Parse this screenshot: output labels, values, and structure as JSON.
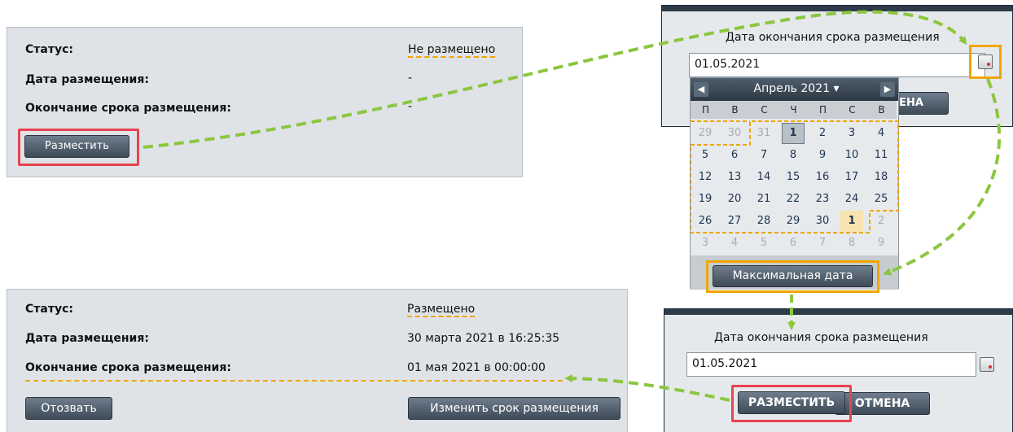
{
  "top_panel": {
    "status_label": "Статус:",
    "status_value": "Не размещено",
    "date_label": "Дата размещения:",
    "date_value": "-",
    "end_label": "Окончание срока размещения:",
    "end_value": "-",
    "place_button": "Разместить"
  },
  "dialog_top": {
    "title": "Дата окончания срока размещения",
    "date_value": "01.05.2021",
    "hidden_button_text": "МЕНА"
  },
  "calendar": {
    "month_label": "Апрель 2021",
    "prev_icon": "◀",
    "next_icon": "▶",
    "dropdown_icon": "▾",
    "weekdays": [
      "П",
      "В",
      "С",
      "Ч",
      "П",
      "С",
      "В"
    ],
    "weeks": [
      [
        "29",
        "30",
        "31",
        "1",
        "2",
        "3",
        "4"
      ],
      [
        "5",
        "6",
        "7",
        "8",
        "9",
        "10",
        "11"
      ],
      [
        "12",
        "13",
        "14",
        "15",
        "16",
        "17",
        "18"
      ],
      [
        "19",
        "20",
        "21",
        "22",
        "23",
        "24",
        "25"
      ],
      [
        "26",
        "27",
        "28",
        "29",
        "30",
        "1",
        "2"
      ],
      [
        "3",
        "4",
        "5",
        "6",
        "7",
        "8",
        "9"
      ]
    ],
    "max_date_button": "Максимальная дата"
  },
  "dialog_bottom": {
    "title": "Дата окончания срока размещения",
    "date_value": "01.05.2021",
    "place_button": "РАЗМЕСТИТЬ",
    "cancel_button": "ОТМЕНА"
  },
  "bottom_panel": {
    "status_label": "Статус:",
    "status_value": "Размещено",
    "date_label": "Дата размещения:",
    "date_value": "30 марта 2021 в 16:25:35",
    "end_label": "Окончание срока размещения:",
    "end_value": "01 мая 2021 в 00:00:00",
    "revoke_button": "Отозвать",
    "change_button": "Изменить срок размещения"
  },
  "colors": {
    "highlight_red": "#e8434f",
    "highlight_gold": "#f0a500",
    "arrow_green": "#8cc63f"
  }
}
